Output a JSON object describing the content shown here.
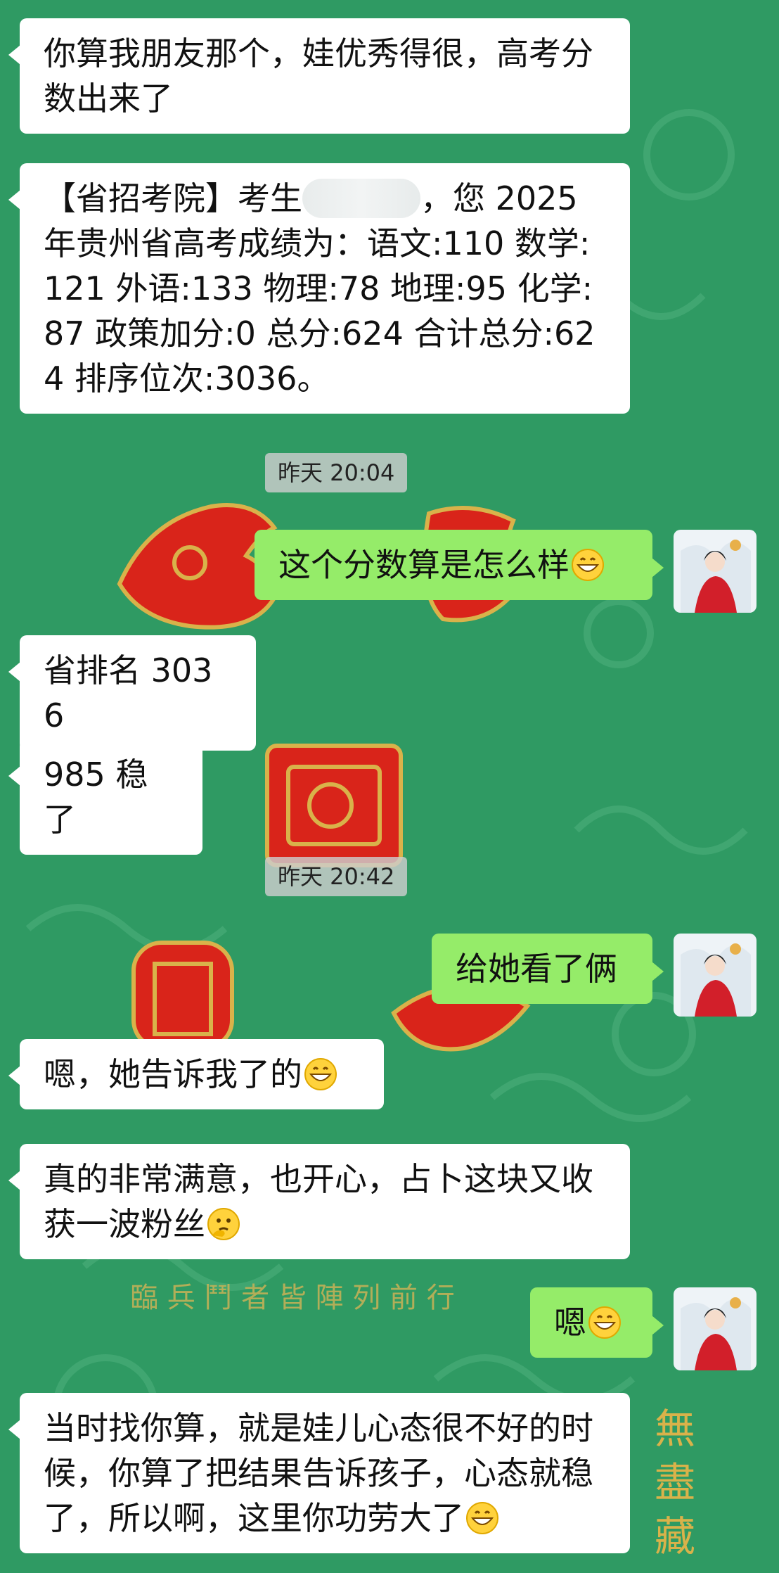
{
  "chat": {
    "messages": [
      {
        "text": "你算我朋友那个，娃优秀得很，高考分数出来了"
      },
      {
        "before": "【省招考院】考生",
        "after": "，您 2025 年贵州省高考成绩为：语文:110 数学:121 外语:133 物理:78 地理:95 化学:87 政策加分:0 总分:624 合计总分:624 排序位次:3036。"
      },
      {
        "time": "昨天 20:04"
      },
      {
        "text": "这个分数算是怎么样",
        "emoji": "grin-emoji"
      },
      {
        "text": "省排名 3036"
      },
      {
        "text": "985 稳了"
      },
      {
        "time": "昨天 20:42"
      },
      {
        "text": "给她看了俩"
      },
      {
        "text": "嗯，她告诉我了的",
        "emoji": "grin-emoji"
      },
      {
        "text": "真的非常满意，也开心，占卜这块又收获一波粉丝",
        "emoji": "thinking-emoji"
      },
      {
        "text": "嗯",
        "emoji": "grin-emoji"
      },
      {
        "text": "当时找你算，就是娃儿心态很不好的时候，你算了把结果告诉孩子，心态就稳了，所以啊，这里你功劳大了",
        "emoji": "grin-emoji"
      }
    ]
  },
  "background": {
    "motto": "臨 兵 鬥 者 皆 陣 列 前 行",
    "seal": "無 盡 藏"
  },
  "colors": {
    "wallpaper": "#2f9a63",
    "incoming_bubble": "#ffffff",
    "outgoing_bubble": "#95ec69",
    "timestamp_bg": "#cdcdcd",
    "seal_red": "#d9241a",
    "seal_gold": "#d9b24a"
  }
}
